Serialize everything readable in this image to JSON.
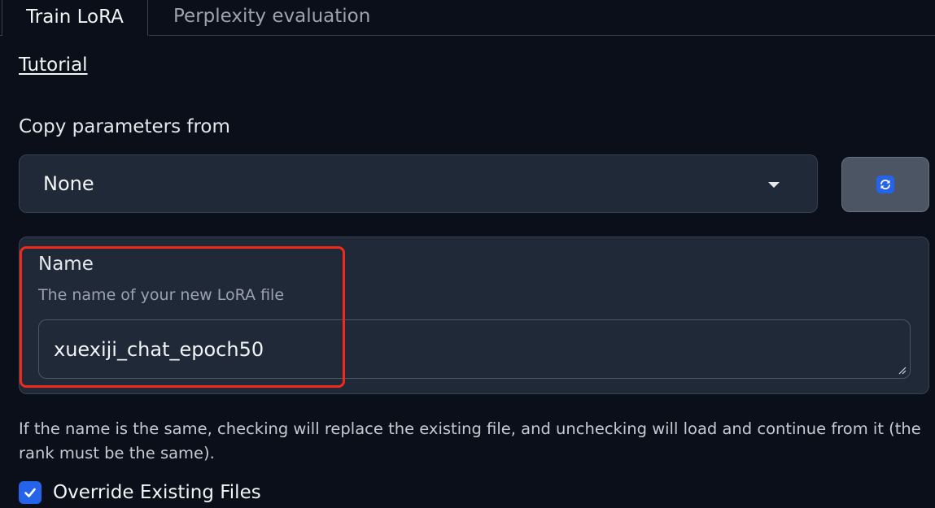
{
  "tabs": [
    {
      "label": "Train LoRA",
      "active": true
    },
    {
      "label": "Perplexity evaluation",
      "active": false
    }
  ],
  "tutorial_link": "Tutorial",
  "copy_params": {
    "label": "Copy parameters from",
    "selected": "None"
  },
  "name_field": {
    "label": "Name",
    "info": "The name of your new LoRA file",
    "value": "xuexiji_chat_epoch50"
  },
  "help_text": "If the name is the same, checking will replace the existing file, and unchecking will load and continue from it (the rank must be the same).",
  "override": {
    "label": "Override Existing Files",
    "checked": true
  },
  "colors": {
    "background": "#0b0f19",
    "panel": "#1f2937",
    "accent": "#2563eb",
    "highlight": "#ef2a1c"
  },
  "icons": {
    "refresh": "refresh-icon",
    "dropdown": "chevron-down-icon",
    "check": "check-icon",
    "resize": "resize-handle-icon"
  }
}
